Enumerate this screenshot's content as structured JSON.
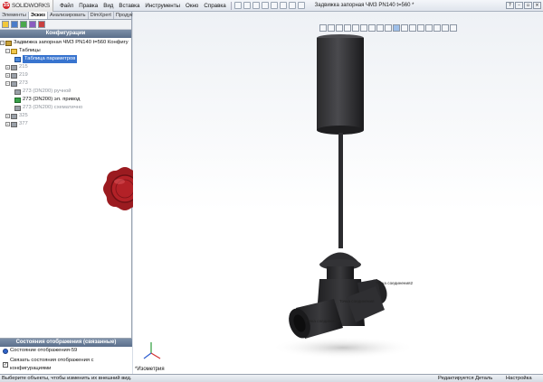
{
  "app": {
    "logo": "SOLIDWORKS",
    "logo_prefix": "SOLID",
    "logo_suffix": "WORKS"
  },
  "menu": [
    "Файл",
    "Правка",
    "Вид",
    "Вставка",
    "Инструменты",
    "Окно",
    "Справка"
  ],
  "document_title": "Задвижка запорная ЧМЗ PN140 t=560 *",
  "left_tabs": [
    "Элементы",
    "Эскиз",
    "Анализировать",
    "DimXpert",
    "Продукты Office"
  ],
  "active_tab": "Эскиз",
  "config_panel": {
    "header": "Конфигурации",
    "root": "Задвижка запорная ЧМЗ PN140 t=560 Конфигу",
    "tables_folder": "Таблицы",
    "param_table": "Таблица параметров",
    "configs": [
      {
        "label": "215",
        "state": "inactive"
      },
      {
        "label": "219",
        "state": "inactive"
      },
      {
        "label": "273",
        "state": "inactive"
      },
      {
        "label": "273 (DN200) ручной",
        "state": "inactive"
      },
      {
        "label": "273 (DN200) эл. привод",
        "state": "active"
      },
      {
        "label": "273 (DN200) схематично",
        "state": "inactive"
      },
      {
        "label": "325",
        "state": "inactive"
      },
      {
        "label": "377",
        "state": "inactive"
      }
    ]
  },
  "display_states": {
    "header": "Состояния отображения (связанные)",
    "item": "Состояние отображения-59",
    "link_checkbox": "Связать состояния отображения с конфигурациями"
  },
  "viewport": {
    "view_name": "*Изометрия",
    "annotations": [
      "Точка соединения2",
      "Точка соединения",
      "Точка соединения"
    ]
  },
  "status_bar": {
    "message": "Выберите объекты, чтобы изменить их внешний вид.",
    "mode": "Редактируется Деталь",
    "setting": "Настройка"
  }
}
